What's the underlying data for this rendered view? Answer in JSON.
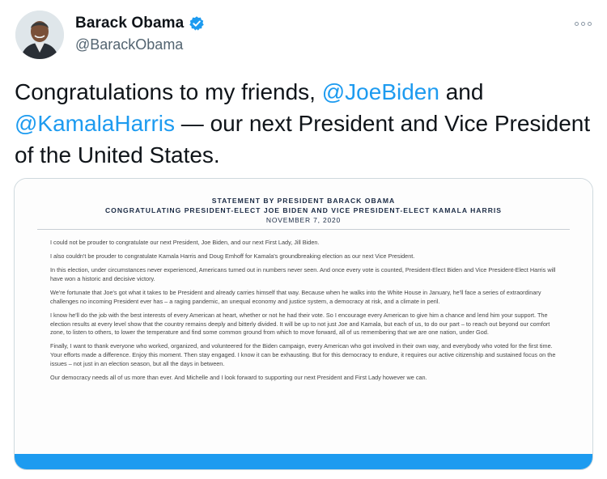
{
  "user": {
    "display_name": "Barack Obama",
    "handle": "@BarackObama",
    "verified": true,
    "avatar_icon": "profile-photo"
  },
  "more_icon": "more-horizontal-icon",
  "tweet": {
    "text_parts": [
      "Congratulations to my friends, ",
      "@JoeBiden",
      " and ",
      "@KamalaHarris",
      " — our next President and Vice President of the United States."
    ]
  },
  "statement": {
    "title_line1": "STATEMENT BY PRESIDENT BARACK OBAMA",
    "title_line2": "CONGRATULATING PRESIDENT-ELECT JOE BIDEN AND VICE PRESIDENT-ELECT KAMALA HARRIS",
    "date": "NOVEMBER 7, 2020",
    "paragraphs": [
      "I could not be prouder to congratulate our next President, Joe Biden, and our next First Lady, Jill Biden.",
      "I also couldn't be prouder to congratulate Kamala Harris and Doug Emhoff for Kamala's groundbreaking election as our next Vice President.",
      "In this election, under circumstances never experienced, Americans turned out in numbers never seen. And once every vote is counted, President-Elect Biden and Vice President-Elect Harris will have won a historic and decisive victory.",
      "We're fortunate that Joe's got what it takes to be President and already carries himself that way. Because when he walks into the White House in January, he'll face a series of extraordinary challenges no incoming President ever has – a raging pandemic, an unequal economy and justice system, a democracy at risk, and a climate in peril.",
      "I know he'll do the job with the best interests of every American at heart, whether or not he had their vote. So I encourage every American to give him a chance and lend him your support. The election results at every level show that the country remains deeply and bitterly divided. It will be up to not just Joe and Kamala, but each of us, to do our part – to reach out beyond our comfort zone, to listen to others, to lower the temperature and find some common ground from which to move forward, all of us remembering that we are one nation, under God.",
      "Finally, I want to thank everyone who worked, organized, and volunteered for the Biden campaign, every American who got involved in their own way, and everybody who voted for the first time. Your efforts made a difference. Enjoy this moment. Then stay engaged. I know it can be exhausting. But for this democracy to endure, it requires our active citizenship and sustained focus on the issues – not just in an election season, but all the days in between.",
      "Our democracy needs all of us more than ever. And Michelle and I look forward to supporting our next President and First Lady however we can."
    ]
  },
  "colors": {
    "accent": "#1d9bf0",
    "text": "#0f1419",
    "secondary": "#536471"
  }
}
